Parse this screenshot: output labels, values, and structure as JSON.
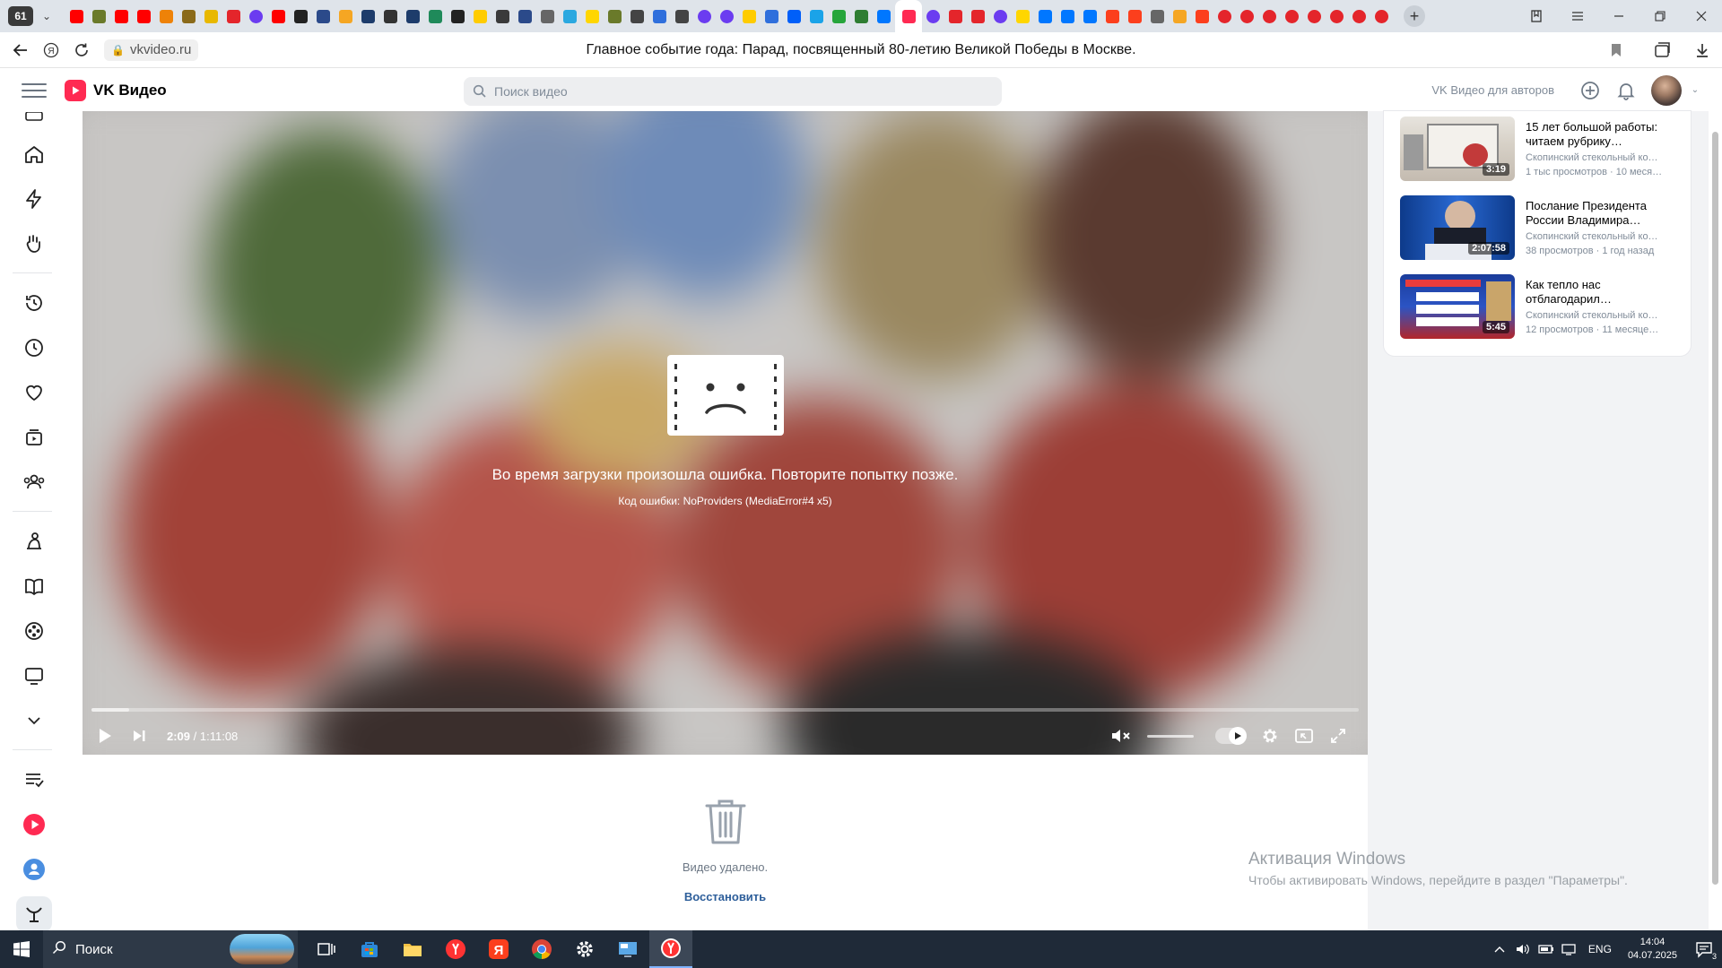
{
  "browser": {
    "tab_count": "61",
    "tab_favicons": [
      {
        "name": "youtube-favicon",
        "color": "#ff0000"
      },
      {
        "name": "ruler-favicon",
        "color": "#6a7a2a"
      },
      {
        "name": "youtube-favicon",
        "color": "#ff0000"
      },
      {
        "name": "youtube-favicon",
        "color": "#ff0000"
      },
      {
        "name": "ok-favicon",
        "color": "#ee8208"
      },
      {
        "name": "code-favicon",
        "color": "#8a6a1a"
      },
      {
        "name": "coin-favicon",
        "color": "#e8b800"
      },
      {
        "name": "huawei-favicon",
        "color": "#e4252b"
      },
      {
        "name": "loop-favicon",
        "color": "#6b3cf0"
      },
      {
        "name": "youtube-favicon",
        "color": "#ff0000"
      },
      {
        "name": "wikipedia-favicon",
        "color": "#222222"
      },
      {
        "name": "emblem-favicon",
        "color": "#2b4a8a"
      },
      {
        "name": "mail-favicon",
        "color": "#f5a623"
      },
      {
        "name": "globe-favicon",
        "color": "#1d3c6b"
      },
      {
        "name": "ya-favicon",
        "color": "#333333"
      },
      {
        "name": "globe-favicon",
        "color": "#1d3c6b"
      },
      {
        "name": "arc-favicon",
        "color": "#1f8a5a"
      },
      {
        "name": "compass-favicon",
        "color": "#222222"
      },
      {
        "name": "dots-favicon",
        "color": "#ffcc00"
      },
      {
        "name": "lg-favicon",
        "color": "#3a3a3a"
      },
      {
        "name": "emblem-favicon",
        "color": "#2b4a8a"
      },
      {
        "name": "doc-favicon",
        "color": "#666666"
      },
      {
        "name": "weather-favicon",
        "color": "#2aa8e0"
      },
      {
        "name": "u-favicon",
        "color": "#ffd600"
      },
      {
        "name": "ruler-favicon",
        "color": "#6a7a2a"
      },
      {
        "name": "bird-favicon",
        "color": "#444444"
      },
      {
        "name": "ua-favicon",
        "color": "#2f6fdc"
      },
      {
        "name": "bird-favicon",
        "color": "#444444"
      },
      {
        "name": "loop-favicon",
        "color": "#6b3cf0"
      },
      {
        "name": "loop-favicon",
        "color": "#6b3cf0"
      },
      {
        "name": "play-favicon",
        "color": "#ffcc00"
      },
      {
        "name": "dots-favicon",
        "color": "#2f6fdc"
      },
      {
        "name": "at-favicon",
        "color": "#005ff9"
      },
      {
        "name": "chat-favicon",
        "color": "#1aa3e8"
      },
      {
        "name": "check-favicon",
        "color": "#26a53b"
      },
      {
        "name": "plane-favicon",
        "color": "#2e7d32"
      },
      {
        "name": "vk-favicon",
        "color": "#0077ff"
      },
      {
        "name": "vkvideo-favicon",
        "color": "#ff2a52"
      },
      {
        "name": "loop-favicon",
        "color": "#6b3cf0"
      },
      {
        "name": "huawei-favicon",
        "color": "#e4252b"
      },
      {
        "name": "huawei-favicon",
        "color": "#e4252b"
      },
      {
        "name": "loop-favicon",
        "color": "#6b3cf0"
      },
      {
        "name": "u-favicon",
        "color": "#ffd600"
      },
      {
        "name": "vk-favicon",
        "color": "#0077ff"
      },
      {
        "name": "vk-favicon",
        "color": "#0077ff"
      },
      {
        "name": "vk-favicon",
        "color": "#0077ff"
      },
      {
        "name": "ya-favicon",
        "color": "#fc3f1d"
      },
      {
        "name": "ya-favicon",
        "color": "#fc3f1d"
      },
      {
        "name": "doc-favicon",
        "color": "#666666"
      },
      {
        "name": "mail-favicon",
        "color": "#f5a623"
      },
      {
        "name": "ya-favicon",
        "color": "#fc3f1d"
      },
      {
        "name": "ring-favicon",
        "color": "#e4252b"
      },
      {
        "name": "ring-favicon",
        "color": "#e4252b"
      },
      {
        "name": "ring-favicon",
        "color": "#e4252b"
      },
      {
        "name": "ring-favicon",
        "color": "#e4252b"
      },
      {
        "name": "ring-favicon",
        "color": "#e4252b"
      },
      {
        "name": "ring-favicon",
        "color": "#e4252b"
      },
      {
        "name": "ring-favicon",
        "color": "#e4252b"
      },
      {
        "name": "ring-favicon",
        "color": "#e4252b"
      }
    ],
    "url": "vkvideo.ru",
    "page_title": "Главное событие года: Парад, посвященный 80-летию Великой Победы в Москве."
  },
  "header": {
    "logo_text": "VK Видео",
    "brand_color": "#ff2a52",
    "search_placeholder": "Поиск видео",
    "authors_link": "VK Видео для авторов"
  },
  "sidebar": {
    "items": [
      {
        "icon": "home-icon"
      },
      {
        "icon": "lightning-icon"
      },
      {
        "icon": "hand-icon"
      },
      {
        "icon": "history-icon"
      },
      {
        "icon": "clock-icon"
      },
      {
        "icon": "heart-icon"
      },
      {
        "icon": "subscriptions-icon"
      },
      {
        "icon": "people-icon"
      },
      {
        "icon": "kids-icon"
      },
      {
        "icon": "book-icon"
      },
      {
        "icon": "film-reel-icon"
      },
      {
        "icon": "tv-icon"
      },
      {
        "icon": "chevron-down-icon"
      },
      {
        "icon": "playlist-icon"
      },
      {
        "icon": "vkvideo-icon"
      },
      {
        "icon": "profile-icon"
      },
      {
        "icon": "channel-icon"
      }
    ]
  },
  "player": {
    "error_message": "Во время загрузки произошла ошибка. Повторите попытку позже.",
    "error_code": "Код ошибки: NoProviders (MediaError#4 x5)",
    "current_time": "2:09",
    "separator": " / ",
    "duration": "1:11:08",
    "progress_fraction": 0.03
  },
  "below_player": {
    "deleted_text": "Видео удалено.",
    "restore_label": "Восстановить"
  },
  "recommendations": [
    {
      "title": "15 лет большой работы: читаем рубрику…",
      "channel": "Скопинский стекольный ко…",
      "meta": "1 тыс просмотров · 10 меся…",
      "duration": "3:19"
    },
    {
      "title": "Послание Президента России Владимира…",
      "channel": "Скопинский стекольный ко…",
      "meta": "38 просмотров · 1 год назад",
      "duration": "2:07:58"
    },
    {
      "title": "Как тепло нас отблагодарил…",
      "channel": "Скопинский стекольный ко…",
      "meta": "12 просмотров · 11 месяце…",
      "duration": "5:45"
    }
  ],
  "windows_activation": {
    "line1": "Активация Windows",
    "line2": "Чтобы активировать Windows, перейдите в раздел \"Параметры\"."
  },
  "taskbar": {
    "search_label": "Поиск",
    "lang": "ENG",
    "time": "14:04",
    "date": "04.07.2025",
    "notification_count": "3"
  }
}
